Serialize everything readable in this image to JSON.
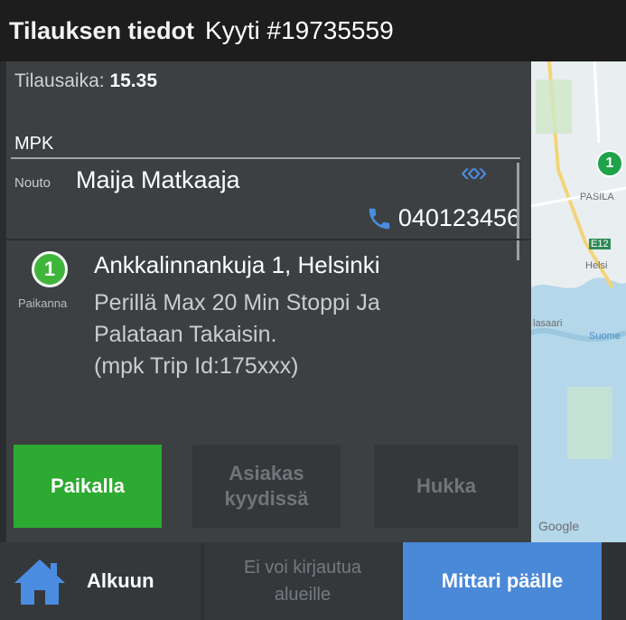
{
  "header": {
    "title": "Tilauksen tiedot",
    "ride": "Kyyti #19735559"
  },
  "order": {
    "time_label": "Tilausaika:",
    "time_value": "15.35",
    "customer": "MPK"
  },
  "pickup": {
    "label": "Nouto",
    "passenger": "Maija Matkaaja",
    "phone": "040123456",
    "expand_icon": "double-chevron-icon",
    "phone_icon": "phone-icon"
  },
  "stop": {
    "number": "1",
    "status_label": "Paikanna",
    "address": "Ankkalinnankuja 1, Helsinki",
    "note_lines": [
      "Perillä Max 20 Min Stoppi Ja",
      "Palataan Takaisin.",
      "(mpk Trip Id:175xxx)"
    ]
  },
  "actions": {
    "here": "Paikalla",
    "onboard_line1": "Asiakas",
    "onboard_line2": "kyydissä",
    "lost": "Hukka"
  },
  "map": {
    "attribution": "Google",
    "labels": [
      "Helsi",
      "Suome",
      "lasaari",
      "PASILA",
      "E12"
    ],
    "marker": "1"
  },
  "bottom": {
    "home": "Alkuun",
    "nologin_line1": "Ei voi kirjautua",
    "nologin_line2": "alueille",
    "meter": "Mittari päälle"
  },
  "colors": {
    "accent_green": "#2daa31",
    "accent_blue": "#4a88d8",
    "panel": "#3c4043"
  }
}
